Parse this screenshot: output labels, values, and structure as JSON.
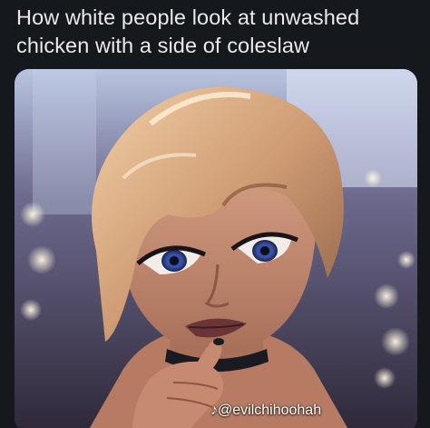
{
  "post": {
    "caption_lines": [
      "How white people look at unwashed",
      "chicken with a side of coleslaw"
    ],
    "watermark": "@evilchihoohah",
    "watermark_logo": "tiktok-note-icon"
  },
  "colors": {
    "background": "#15181d",
    "caption_text": "#e9eaec",
    "watermark_text": "#ffffff"
  }
}
